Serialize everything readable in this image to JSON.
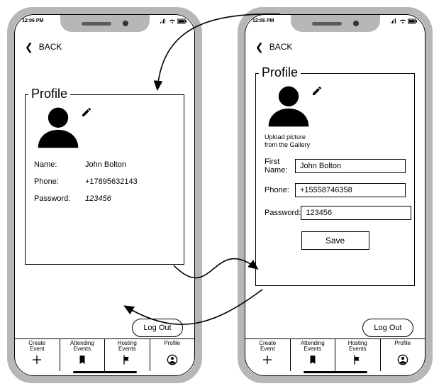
{
  "status_time": "12:06 PM",
  "back_label": "BACK",
  "profile_title": "Profile",
  "upload_note_line1": "Upload picture",
  "upload_note_line2": "from the Gallery",
  "view": {
    "name_label": "Name:",
    "name_value": "John Bolton",
    "phone_label": "Phone:",
    "phone_value": "+17895632143",
    "password_label": "Password:",
    "password_value": "123456"
  },
  "edit": {
    "first_name_label": "First Name:",
    "first_name_value": "John Bolton",
    "phone_label": "Phone:",
    "phone_value": "+15558746358",
    "password_label": "Password:",
    "password_value": "123456",
    "save_label": "Save"
  },
  "logout_label": "Log Out",
  "nav": {
    "create_line1": "Create",
    "create_line2": "Event",
    "attending_line1": "Attending",
    "attending_line2": "Events",
    "hosting_line1": "Hosting",
    "hosting_line2": "Events",
    "profile": "Profile"
  }
}
